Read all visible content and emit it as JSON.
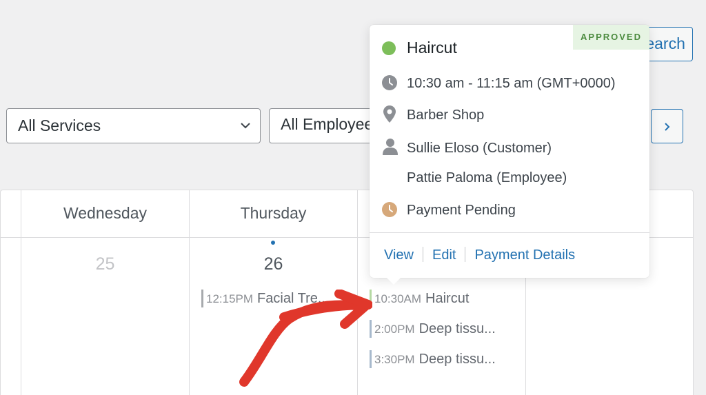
{
  "search": {
    "label": "Search"
  },
  "filters": {
    "services": "All Services",
    "employees": "All Employees"
  },
  "nav": {
    "next_icon": "chevron-right-icon"
  },
  "calendar": {
    "days": [
      {
        "name": "Wednesday",
        "number": "25"
      },
      {
        "name": "Thursday",
        "number": "26"
      }
    ],
    "events": [
      {
        "time": "12:15PM",
        "title": "Facial Tre...",
        "color": "#a7aaad"
      },
      {
        "time": "10:30AM",
        "title": "Haircut",
        "color": "#b5d9a3"
      },
      {
        "time": "2:00PM",
        "title": "Deep tissu...",
        "color": "#a7b9cc"
      },
      {
        "time": "3:30PM",
        "title": "Deep tissu...",
        "color": "#a7b9cc"
      }
    ]
  },
  "popover": {
    "status": "APPROVED",
    "status_color": "#4c8b3f",
    "title": "Haircut",
    "time": "10:30 am - 11:15 am (GMT+0000)",
    "location": "Barber Shop",
    "customer": "Sullie Eloso (Customer)",
    "employee": "Pattie Paloma (Employee)",
    "payment": "Payment Pending",
    "actions": {
      "view": "View",
      "edit": "Edit",
      "payment_details": "Payment Details"
    }
  },
  "colors": {
    "accent": "#2271b1",
    "approved": "#7dbe5a",
    "pending": "#d6a87a",
    "annotation": "#e0372b"
  }
}
